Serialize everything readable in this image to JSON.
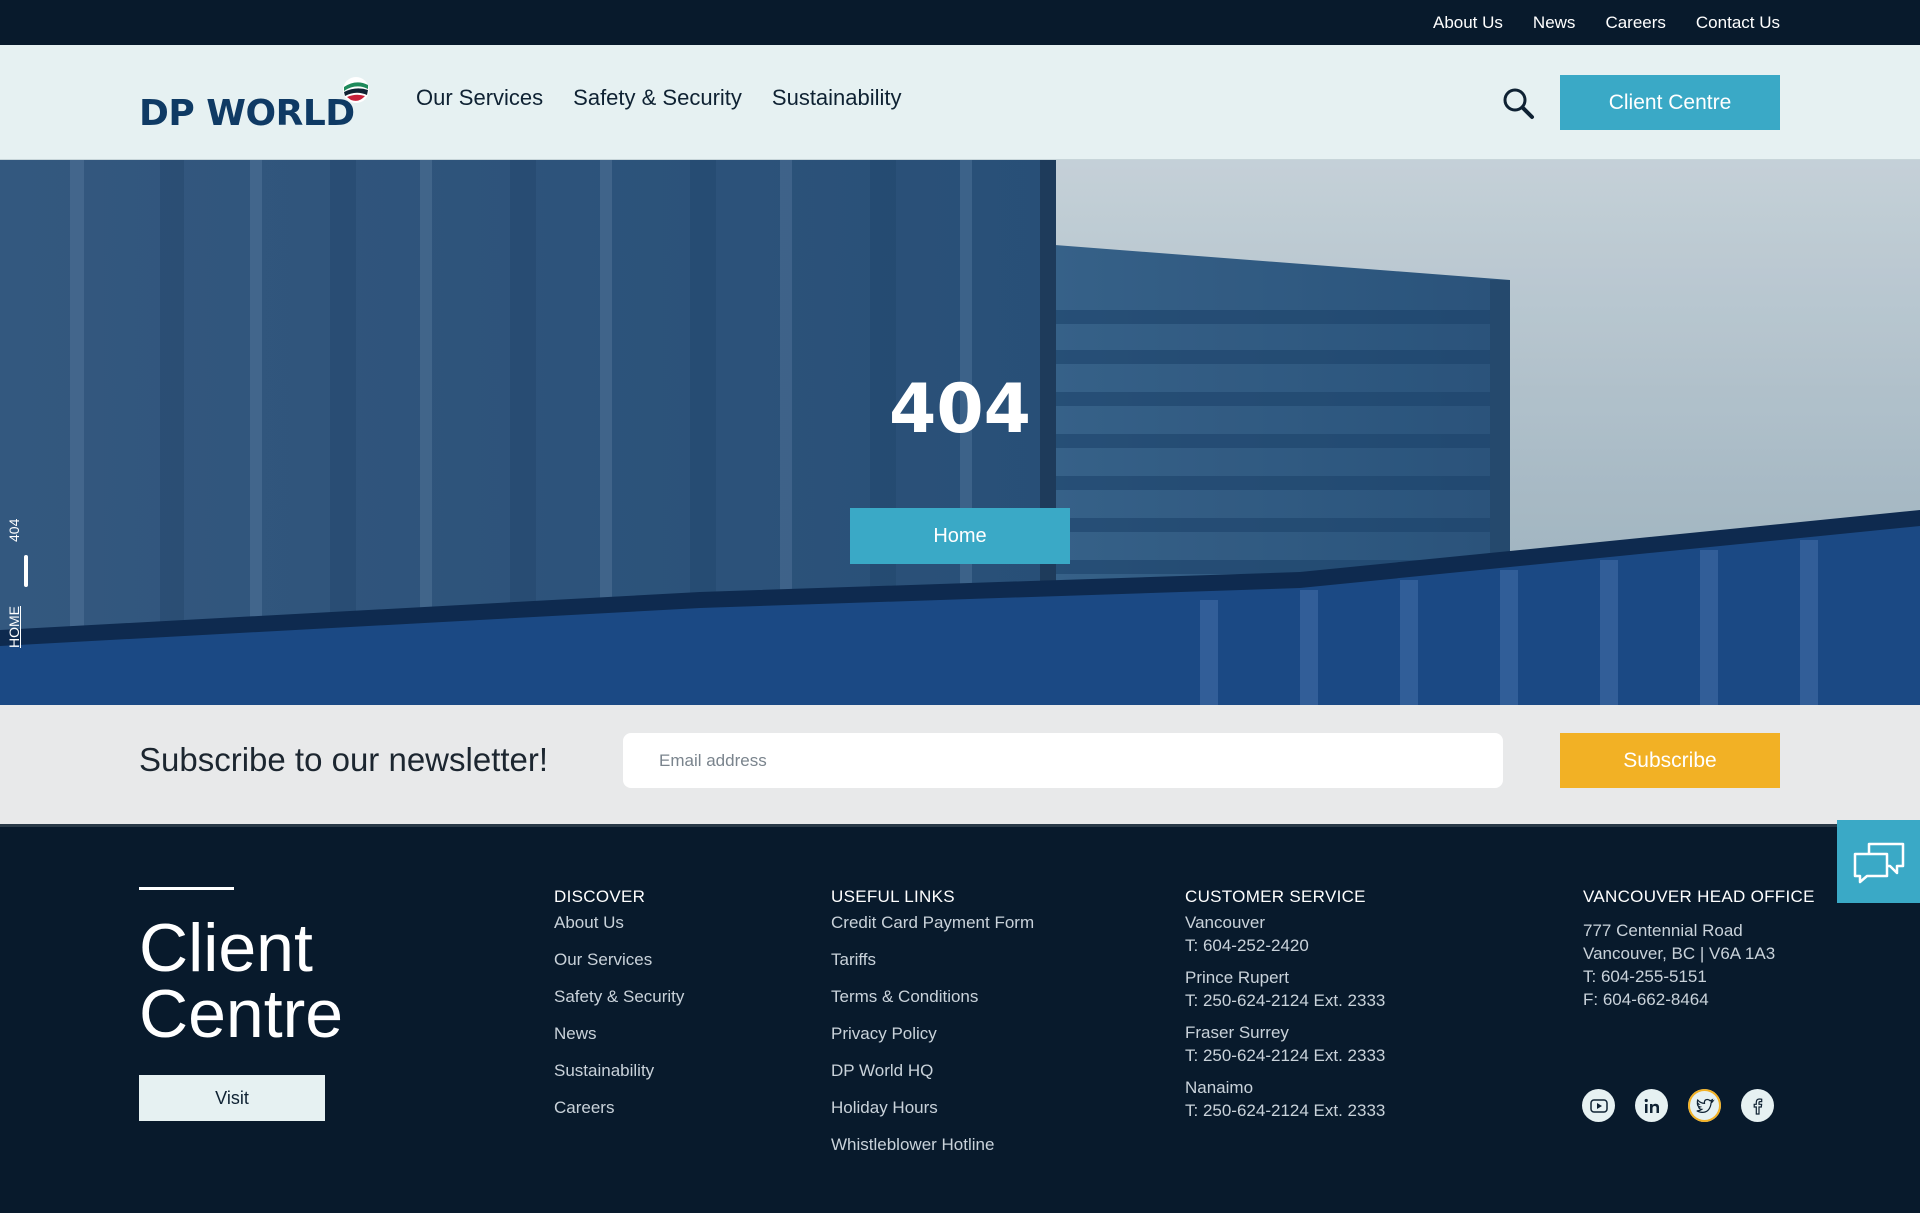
{
  "topbar": {
    "links": [
      "About Us",
      "News",
      "Careers",
      "Contact Us"
    ]
  },
  "header": {
    "logo_text": "DP WORLD",
    "nav": [
      "Our Services",
      "Safety & Security",
      "Sustainability"
    ],
    "client_button": "Client Centre"
  },
  "hero": {
    "title": "404",
    "button": "Home",
    "breadcrumb": {
      "home": "HOME",
      "current": "404"
    }
  },
  "newsletter": {
    "title": "Subscribe to our newsletter!",
    "email_placeholder": "Email address",
    "button": "Subscribe"
  },
  "footer": {
    "client_centre": {
      "title_line1": "Client",
      "title_line2": "Centre",
      "button": "Visit"
    },
    "discover": {
      "heading": "DISCOVER",
      "links": [
        "About Us",
        "Our Services",
        "Safety & Security",
        "News",
        "Sustainability",
        "Careers"
      ]
    },
    "useful_links": {
      "heading": "USEFUL LINKS",
      "links": [
        "Credit Card Payment Form",
        "Tariffs",
        "Terms & Conditions",
        "Privacy Policy",
        "DP World HQ",
        "Holiday Hours",
        "Whistleblower Hotline"
      ]
    },
    "customer_service": {
      "heading": "CUSTOMER SERVICE",
      "locations": [
        {
          "name": "Vancouver",
          "phone": "T: 604-252-2420"
        },
        {
          "name": "Prince Rupert",
          "phone": "T: 250-624-2124 Ext. 2333"
        },
        {
          "name": "Fraser Surrey",
          "phone": "T: 250-624-2124 Ext. 2333"
        },
        {
          "name": "Nanaimo",
          "phone": "T: 250-624-2124 Ext. 2333"
        }
      ]
    },
    "head_office": {
      "heading": "VANCOUVER HEAD OFFICE",
      "lines": [
        "777 Centennial Road",
        "Vancouver, BC | V6A 1A3",
        "T: 604-255-5151",
        "F: 604-662-8464"
      ]
    },
    "socials": [
      "youtube-icon",
      "linkedin-icon",
      "twitter-icon",
      "facebook-icon"
    ]
  },
  "colors": {
    "navy": "#081a2c",
    "accent_teal": "#3aa9c6",
    "accent_yellow": "#f2b125",
    "header_bg": "#e6f1f2",
    "logo_blue": "#0f3a64"
  }
}
